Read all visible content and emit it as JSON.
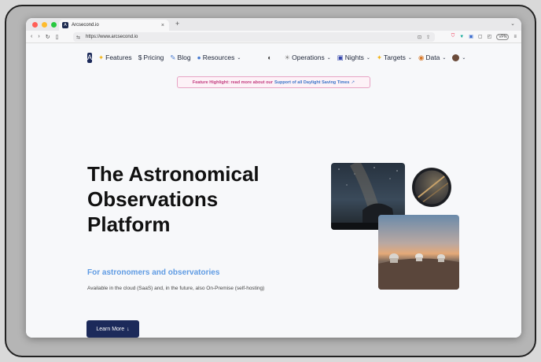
{
  "browser": {
    "tab_title": "Arcsecond.io",
    "tab_close": "×",
    "new_tab": "+",
    "url": "https://www.arcsecond.io",
    "vpn_label": "VPN"
  },
  "site": {
    "logo_letter": "A",
    "nav": {
      "features": "Features",
      "pricing": "Pricing",
      "blog": "Blog",
      "resources": "Resources",
      "operations": "Operations",
      "nights": "Nights",
      "targets": "Targets",
      "data": "Data"
    },
    "banner": {
      "text": "Feature Highlight: read more about our",
      "link": "Support of all Daylight Saving Times"
    },
    "hero": {
      "title_line1": "The Astronomical",
      "title_line2": "Observations",
      "title_line3": "Platform",
      "subhead": "For astronomers and observatories",
      "description": "Available in the cloud (SaaS) and, in the future, also On-Premise (self-hosting)",
      "cta": "Learn More"
    }
  },
  "colors": {
    "accent": "#1c2a5a",
    "banner_text": "#c23a7e",
    "subhead": "#5f9be3"
  }
}
